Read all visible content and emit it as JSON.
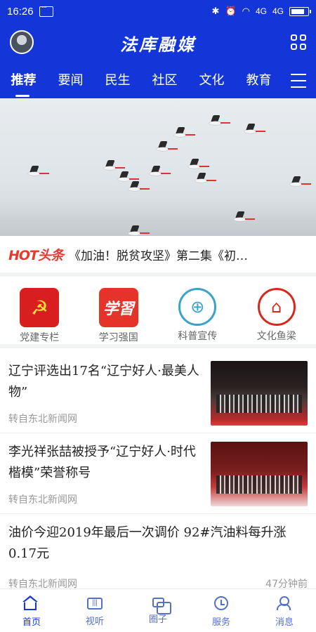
{
  "status_bar": {
    "time": "16:26",
    "signal1": "4G",
    "signal2": "4G"
  },
  "header": {
    "title": "法库融媒"
  },
  "tabs": [
    {
      "label": "推荐",
      "active": true
    },
    {
      "label": "要闻"
    },
    {
      "label": "民生"
    },
    {
      "label": "社区"
    },
    {
      "label": "文化"
    },
    {
      "label": "教育"
    }
  ],
  "hot": {
    "badge": "HOT头条",
    "text": "《加油！脱贫攻坚》第二集《初…"
  },
  "quick_channels": [
    {
      "label": "党建专栏",
      "icon": "party-emblem-icon"
    },
    {
      "label": "学习强国",
      "icon": "xuexi-icon"
    },
    {
      "label": "科普宣传",
      "icon": "science-globe-icon"
    },
    {
      "label": "文化鱼梁",
      "icon": "culture-pavilion-icon"
    }
  ],
  "news": [
    {
      "title": "辽宁评选出17名“辽宁好人·最美人物”",
      "source": "转自东北新闻网"
    },
    {
      "title": "李光祥张喆被授予“辽宁好人·时代楷模”荣誉称号",
      "source": "转自东北新闻网"
    },
    {
      "title": "油价今迎2019年最后一次调价 92#汽油料每升涨0.17元",
      "source": "转自东北新闻网",
      "time": "47分钟前"
    }
  ],
  "bottom_nav": [
    {
      "label": "首页",
      "icon": "home-icon",
      "active": true
    },
    {
      "label": "视听",
      "icon": "tv-icon"
    },
    {
      "label": "圈子",
      "icon": "circle-icon"
    },
    {
      "label": "服务",
      "icon": "clock-icon"
    },
    {
      "label": "消息",
      "icon": "message-icon"
    }
  ],
  "colors": {
    "brand": "#1436d9",
    "hot": "#e53a2f"
  }
}
